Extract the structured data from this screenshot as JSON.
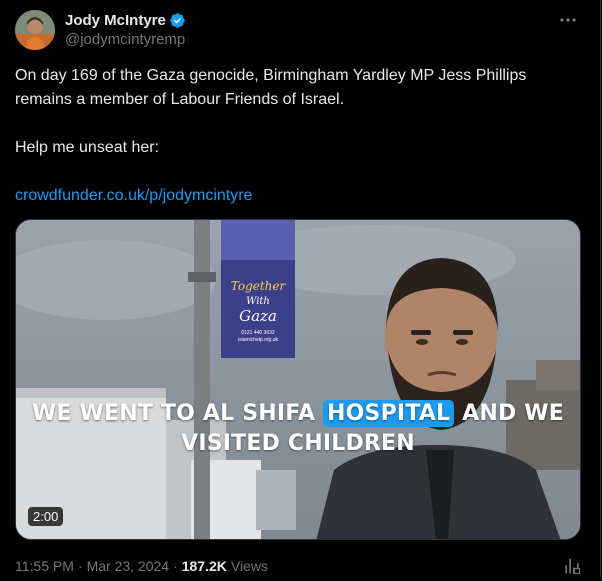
{
  "post": {
    "author": {
      "display_name": "Jody McIntyre",
      "handle": "@jodymcintyremp",
      "verified_icon": "verified-badge-icon",
      "avatar_icon": "avatar"
    },
    "more_icon": "more-icon",
    "text": {
      "line1": "On day 169 of the Gaza genocide, Birmingham Yardley MP Jess Phillips remains a member of Labour Friends of Israel.",
      "line2": "Help me unseat her:",
      "link": "crowdfunder.co.uk/p/jodymcintyre"
    },
    "video": {
      "caption_line1_before": "WE WENT TO AL SHIFA",
      "caption_line1_highlight": "HOSPITAL",
      "caption_line1_after": "AND WE",
      "caption_line2": "VISITED CHILDREN",
      "banner_text_1": "Together",
      "banner_text_2": "With",
      "banner_text_3": "Gaza",
      "banner_small_1": "0121 440 3632",
      "banner_small_2": "islamichelp.org.uk",
      "duration": "2:00"
    },
    "meta": {
      "time": "11:55 PM",
      "date": "Mar 23, 2024",
      "separator": "·",
      "views_count": "187.2K",
      "views_label": "Views"
    },
    "analytics_icon": "analytics-icon"
  },
  "colors": {
    "background": "#000000",
    "text_primary": "#e7e9ea",
    "text_secondary": "#71767b",
    "accent": "#1d9bf0"
  }
}
